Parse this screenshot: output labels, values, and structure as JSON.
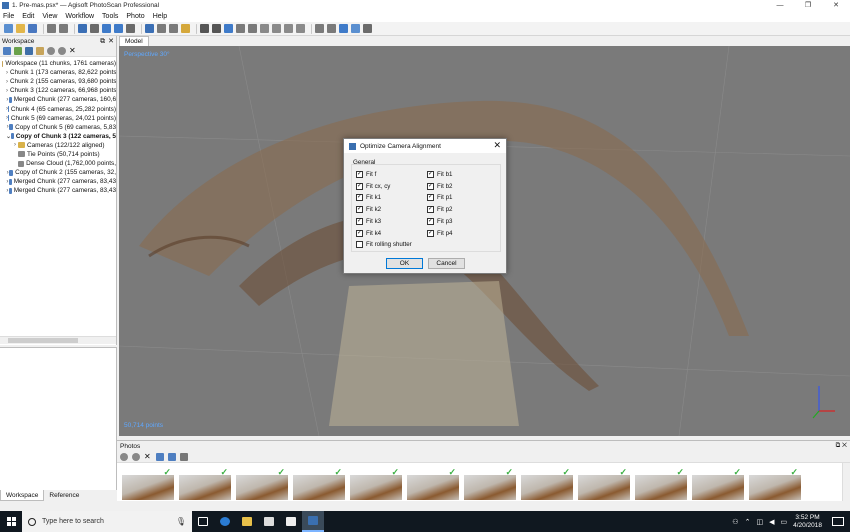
{
  "window": {
    "title": "1. Pre-mas.psx* — Agisoft PhotoScan Professional",
    "controls": [
      "—",
      "❐",
      "✕"
    ]
  },
  "menu": [
    "File",
    "Edit",
    "View",
    "Workflow",
    "Tools",
    "Photo",
    "Help"
  ],
  "workspace": {
    "header": "Workspace",
    "tree": [
      {
        "label": "Workspace (11 chunks, 1761 cameras)",
        "indent": 0,
        "arrow": "",
        "bold": false,
        "icon": "workspace-icon",
        "color": "#c7a45a"
      },
      {
        "label": "Chunk 1 (173 cameras, 82,622 points)",
        "indent": 1,
        "arrow": "›",
        "bold": false,
        "icon": "chunk-icon",
        "color": "#4f7fc1"
      },
      {
        "label": "Chunk 2 (155 cameras, 93,680 points)",
        "indent": 1,
        "arrow": "›",
        "bold": false,
        "icon": "chunk-icon",
        "color": "#4f7fc1"
      },
      {
        "label": "Chunk 3 (122 cameras, 66,968 points)",
        "indent": 1,
        "arrow": "›",
        "bold": false,
        "icon": "chunk-icon",
        "color": "#4f7fc1"
      },
      {
        "label": "Merged Chunk (277 cameras, 160,6",
        "indent": 1,
        "arrow": "›",
        "bold": false,
        "icon": "chunk-icon",
        "color": "#4f7fc1"
      },
      {
        "label": "Chunk 4 (65 cameras, 25,282 points)",
        "indent": 1,
        "arrow": "›",
        "bold": false,
        "icon": "chunk-icon",
        "color": "#4f7fc1"
      },
      {
        "label": "Chunk 5 (69 cameras, 24,021 points)",
        "indent": 1,
        "arrow": "›",
        "bold": false,
        "icon": "chunk-icon",
        "color": "#4f7fc1"
      },
      {
        "label": "Copy of Chunk 5 (69 cameras, 5,83",
        "indent": 1,
        "arrow": "›",
        "bold": false,
        "icon": "chunk-icon",
        "color": "#4f7fc1"
      },
      {
        "label": "Copy of Chunk 3 (122 cameras, 5",
        "indent": 1,
        "arrow": "⌄",
        "bold": true,
        "icon": "chunk-icon",
        "color": "#4f7fc1"
      },
      {
        "label": "Cameras (122/122 aligned)",
        "indent": 2,
        "arrow": "›",
        "bold": false,
        "icon": "folder-icon",
        "color": "#d9b24a"
      },
      {
        "label": "Tie Points (50,714 points)",
        "indent": 2,
        "arrow": "",
        "bold": false,
        "icon": "tie-points-icon",
        "color": "#888888"
      },
      {
        "label": "Dense Cloud (1,762,000 points,",
        "indent": 2,
        "arrow": "",
        "bold": false,
        "icon": "dense-cloud-icon",
        "color": "#888888"
      },
      {
        "label": "Copy of Chunk 2 (155 cameras, 32,",
        "indent": 1,
        "arrow": "›",
        "bold": false,
        "icon": "chunk-icon",
        "color": "#4f7fc1"
      },
      {
        "label": "Merged Chunk (277 cameras, 83,43",
        "indent": 1,
        "arrow": "›",
        "bold": false,
        "icon": "chunk-icon",
        "color": "#4f7fc1"
      },
      {
        "label": "Merged Chunk (277 cameras, 83,43",
        "indent": 1,
        "arrow": "›",
        "bold": false,
        "icon": "chunk-icon",
        "color": "#4f7fc1"
      }
    ]
  },
  "bottom_tabs": [
    "Workspace",
    "Reference"
  ],
  "model": {
    "tab": "Model",
    "view_label": "Perspective 30°",
    "points_label": "50,714 points"
  },
  "dialog": {
    "title": "Optimize Camera Alignment",
    "group": "General",
    "left_options": [
      {
        "label": "Fit f",
        "checked": true
      },
      {
        "label": "Fit cx, cy",
        "checked": true
      },
      {
        "label": "Fit k1",
        "checked": true
      },
      {
        "label": "Fit k2",
        "checked": true
      },
      {
        "label": "Fit k3",
        "checked": true
      },
      {
        "label": "Fit k4",
        "checked": true
      },
      {
        "label": "Fit rolling shutter",
        "checked": false
      }
    ],
    "right_options": [
      {
        "label": "Fit b1",
        "checked": true
      },
      {
        "label": "Fit b2",
        "checked": true
      },
      {
        "label": "Fit p1",
        "checked": true
      },
      {
        "label": "Fit p2",
        "checked": true
      },
      {
        "label": "Fit p3",
        "checked": true
      },
      {
        "label": "Fit p4",
        "checked": true
      }
    ],
    "ok": "OK",
    "cancel": "Cancel"
  },
  "photos": {
    "header": "Photos",
    "count_visible": 12
  },
  "taskbar": {
    "search_placeholder": "Type here to search",
    "time": "3:52 PM",
    "date": "4/20/2018"
  },
  "colors": {
    "accent": "#0078d7",
    "viewport_bg": "#7a7a7a",
    "viewport_text": "#5fa8ff",
    "check_green": "#3cb043"
  }
}
